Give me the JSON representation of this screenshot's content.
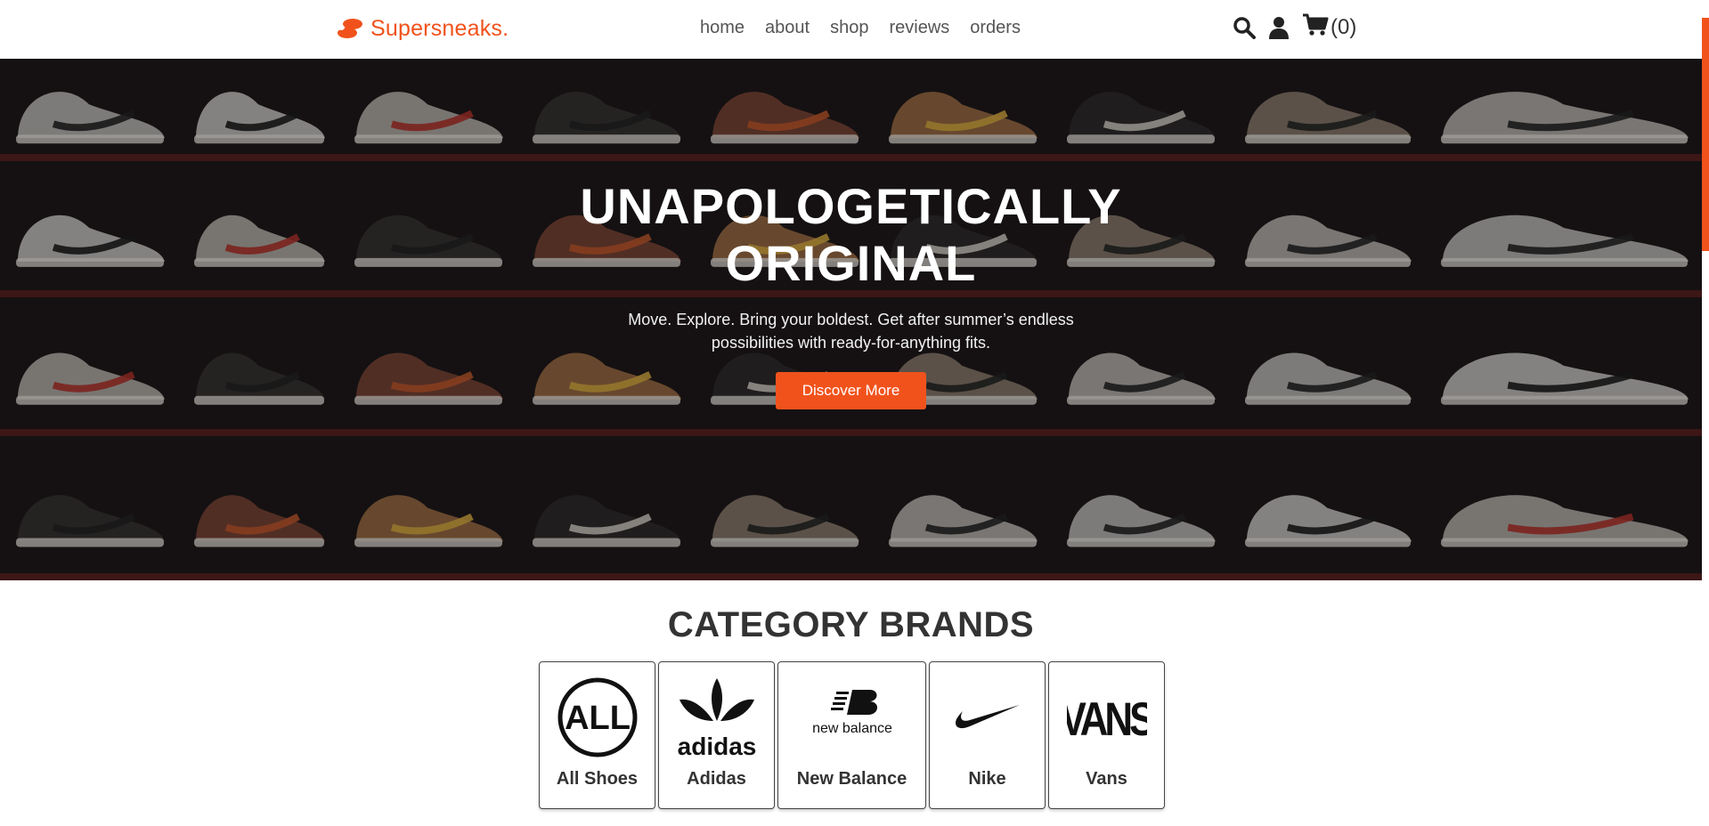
{
  "header": {
    "brand_name": "Supersneaks.",
    "nav": [
      "home",
      "about",
      "shop",
      "reviews",
      "orders"
    ],
    "cart_count": "(0)"
  },
  "hero": {
    "title_line1": "UNAPOLOGETICALLY",
    "title_line2": "ORIGINAL",
    "subtitle": "Move. Explore. Bring your boldest. Get after summer’s endless possibilities with ready-for-anything fits.",
    "cta": "Discover More"
  },
  "categories": {
    "title": "CATEGORY BRANDS",
    "items": [
      {
        "label": "All Shoes",
        "logo": "ALL",
        "icon": "all-shoes-logo"
      },
      {
        "label": "Adidas",
        "logo": "adidas",
        "icon": "adidas-logo"
      },
      {
        "label": "New Balance",
        "logo": "new balance",
        "icon": "new-balance-logo"
      },
      {
        "label": "Nike",
        "logo": "",
        "icon": "nike-swoosh-logo"
      },
      {
        "label": "Vans",
        "logo": "VANS",
        "icon": "vans-logo"
      }
    ]
  },
  "colors": {
    "accent": "#f1521c",
    "text": "#333333"
  }
}
